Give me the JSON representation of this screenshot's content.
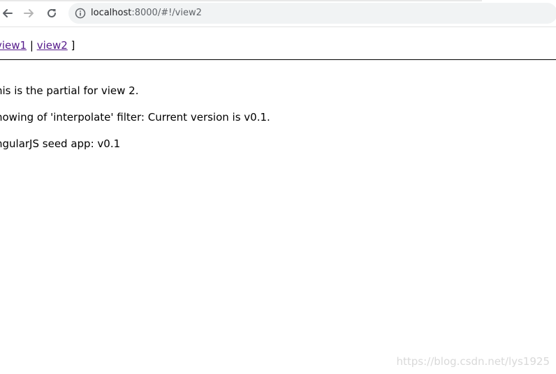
{
  "browser": {
    "url_host": "localhost",
    "url_path": ":8000/#!/view2",
    "back_icon": "arrow-left-icon",
    "forward_icon": "arrow-right-icon",
    "reload_icon": "reload-icon",
    "info_icon": "info-icon"
  },
  "menu": {
    "view1_label": "view1",
    "separator": " | ",
    "view2_label": "view2",
    "close_bracket": " ]"
  },
  "content": {
    "line1": "his is the partial for view 2.",
    "line2": "howing of 'interpolate' filter: Current version is v0.1.",
    "line3": "ngularJS seed app: v0.1"
  },
  "watermark": "https://blog.csdn.net/lys1925"
}
